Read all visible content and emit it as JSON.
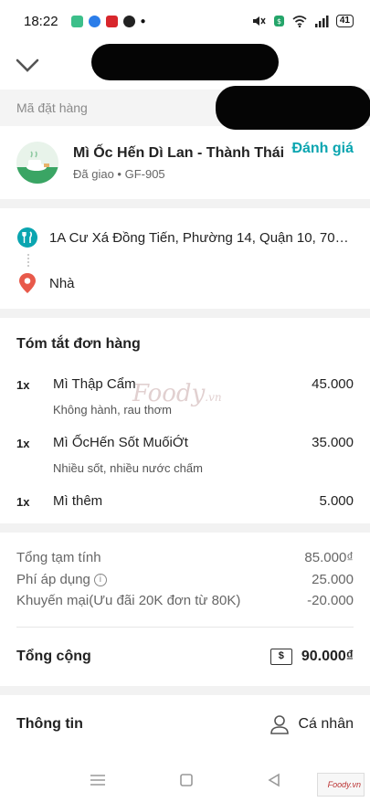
{
  "status_bar": {
    "time": "18:22",
    "battery": "41"
  },
  "header": {
    "order_id_label": "Mã đặt hàng"
  },
  "restaurant": {
    "name": "Mì Ốc Hến Dì Lan - Thành Thái",
    "status": "Đã giao • GF-905",
    "rate_label": "Đánh giá"
  },
  "address": {
    "pickup": "1A Cư Xá Đồng Tiến, Phường 14, Quận 10, 700...",
    "dropoff": "Nhà"
  },
  "summary": {
    "title": "Tóm tắt đơn hàng",
    "items": [
      {
        "qty": "1x",
        "name": "Mì Thập Cẩm",
        "note": "Không hành, rau thơm",
        "price": "45.000"
      },
      {
        "qty": "1x",
        "name": "Mì ỐcHến Sốt MuốiỚt",
        "note": "Nhiều sốt, nhiều nước chấm",
        "price": "35.000"
      },
      {
        "qty": "1x",
        "name": "Mì thêm",
        "note": "",
        "price": "5.000"
      }
    ]
  },
  "totals": {
    "subtotal_label": "Tổng tạm tính",
    "subtotal_value": "85.000₫",
    "fee_label": "Phí áp dụng",
    "fee_value": "25.000",
    "promo_label": "Khuyến mại(Ưu đãi 20K đơn từ 80K)",
    "promo_value": "-20.000",
    "grand_label": "Tổng cộng",
    "grand_value": "90.000₫",
    "cash_symbol": "$"
  },
  "info": {
    "title": "Thông tin",
    "profile_label": "Cá nhân"
  },
  "watermark": {
    "text": "Foody",
    "suffix": ".vn",
    "corner": "Foody.vn"
  },
  "colors": {
    "accent": "#0aa5b0",
    "pin": "#e8594a"
  },
  "icons": {
    "back": "chevron-down-icon",
    "restaurant": "utensils-icon",
    "destination": "location-pin-icon",
    "info": "info-icon",
    "cash": "cash-icon",
    "profile": "person-icon"
  }
}
